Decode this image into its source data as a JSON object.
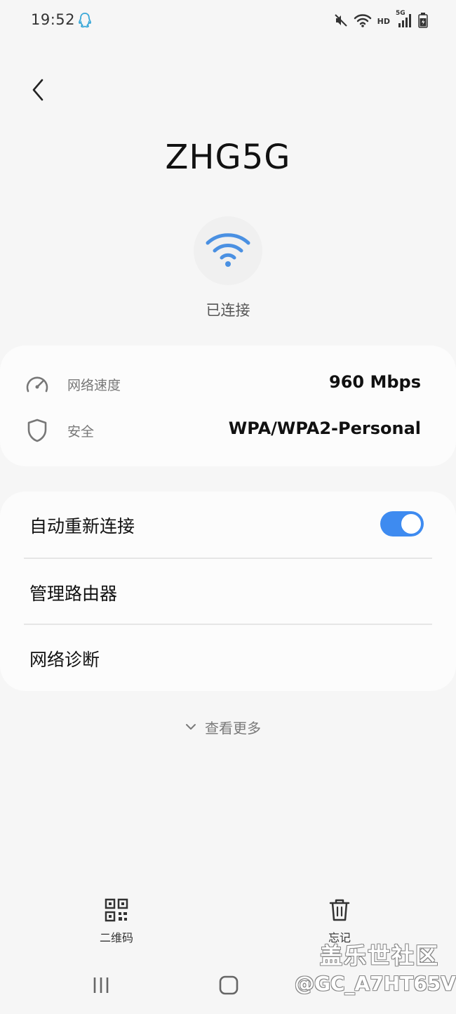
{
  "status_bar": {
    "time": "19:52",
    "icons": [
      "qq-icon",
      "mute-icon",
      "wifi-icon",
      "hd-icon",
      "signal-icon",
      "battery-icon"
    ],
    "hd_label": "HD",
    "network_type": "5G"
  },
  "header": {
    "back_icon": "chevron-left-icon",
    "network_name": "ZHG5G",
    "wifi_icon": "wifi-icon",
    "status": "已连接"
  },
  "info": {
    "rows": [
      {
        "icon": "speedometer-icon",
        "label": "网络速度",
        "value": "960 Mbps"
      },
      {
        "icon": "shield-icon",
        "label": "安全",
        "value": "WPA/WPA2-Personal"
      }
    ]
  },
  "settings": {
    "auto_reconnect": {
      "label": "自动重新连接",
      "enabled": true
    },
    "manage_router": {
      "label": "管理路由器"
    },
    "network_diagnosis": {
      "label": "网络诊断"
    }
  },
  "see_more": {
    "label": "查看更多",
    "icon": "chevron-down-icon"
  },
  "actions": {
    "qr": {
      "label": "二维码",
      "icon": "qr-code-icon"
    },
    "forget": {
      "label": "忘记",
      "icon": "trash-icon"
    }
  },
  "watermark": {
    "title": "盖乐世社区",
    "user": "@GC_A7HT65V"
  },
  "colors": {
    "accent": "#3e8bf0",
    "wifi_blue": "#4a90e2",
    "background": "#f6f6f6",
    "card": "#fcfcfc"
  }
}
